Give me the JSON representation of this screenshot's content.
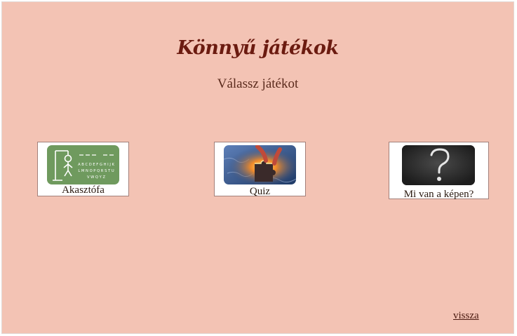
{
  "page": {
    "title": "Könnyű játékok",
    "subtitle": "Válassz játékot",
    "back_link": "vissza"
  },
  "games": [
    {
      "label": "Akasztófa",
      "icon": "hangman-icon",
      "thumb_letters": [
        "A B C D E F G H I J K",
        "L M N O P Q R S T U",
        "V W Q Y Z"
      ]
    },
    {
      "label": "Quiz",
      "icon": "puzzle-piece-icon"
    },
    {
      "label": "Mi van a képen?",
      "icon": "question-mark-icon"
    }
  ],
  "colors": {
    "background": "#f3c3b4",
    "title": "#6b1b10",
    "hangman_bg": "#6f9a5e",
    "quiz_bg": "#2d4f86",
    "question_bg": "#2b2b2b"
  }
}
